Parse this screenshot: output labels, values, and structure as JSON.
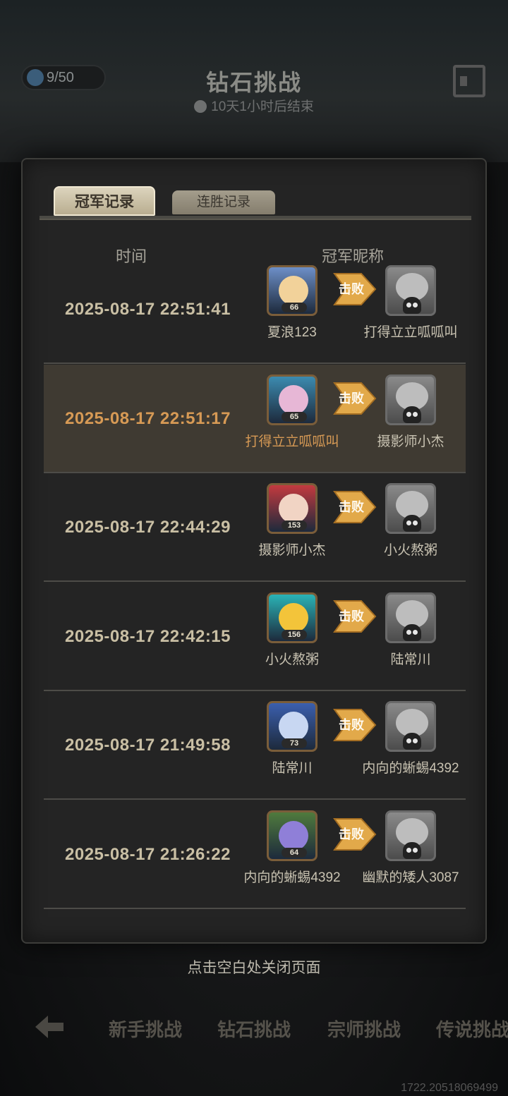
{
  "header": {
    "energy": "9/50",
    "title": "钻石挑战",
    "timer": "10天1小时后结束"
  },
  "tabs": [
    {
      "label": "冠军记录",
      "active": true
    },
    {
      "label": "连胜记录",
      "active": false
    }
  ],
  "columns": {
    "time": "时间",
    "champion": "冠军昵称"
  },
  "defeat_label": "击败",
  "records": [
    {
      "time": "2025-08-17  22:51:41",
      "winner": "夏浪123",
      "winner_level": "66",
      "loser": "打得立立呱呱叫",
      "winner_color": "#f2d29a",
      "winner_bg": "#6d8fc7"
    },
    {
      "time": "2025-08-17  22:51:17",
      "winner": "打得立立呱呱叫",
      "winner_level": "65",
      "loser": "摄影师小杰",
      "winner_color": "#e7b7d6",
      "winner_bg": "#3c8bb0"
    },
    {
      "time": "2025-08-17  22:44:29",
      "winner": "摄影师小杰",
      "winner_level": "153",
      "loser": "小火熬粥",
      "winner_color": "#f1d4c4",
      "winner_bg": "#c33a3f"
    },
    {
      "time": "2025-08-17  22:42:15",
      "winner": "小火熬粥",
      "winner_level": "156",
      "loser": "陆常川",
      "winner_color": "#f3c43a",
      "winner_bg": "#2ab3b6"
    },
    {
      "time": "2025-08-17  21:49:58",
      "winner": "陆常川",
      "winner_level": "73",
      "loser": "内向的蜥蜴4392",
      "winner_color": "#c8d7f2",
      "winner_bg": "#3b5fae"
    },
    {
      "time": "2025-08-17  21:26:22",
      "winner": "内向的蜥蜴4392",
      "winner_level": "64",
      "loser": "幽默的矮人3087",
      "winner_color": "#8f7fd8",
      "winner_bg": "#4f7a3d"
    }
  ],
  "highlighted_index": 1,
  "close_hint": "点击空白处关闭页面",
  "bottom_nav": [
    "新手挑战",
    "钻石挑战",
    "宗师挑战",
    "传说挑战"
  ],
  "build_id": "1722.20518069499"
}
